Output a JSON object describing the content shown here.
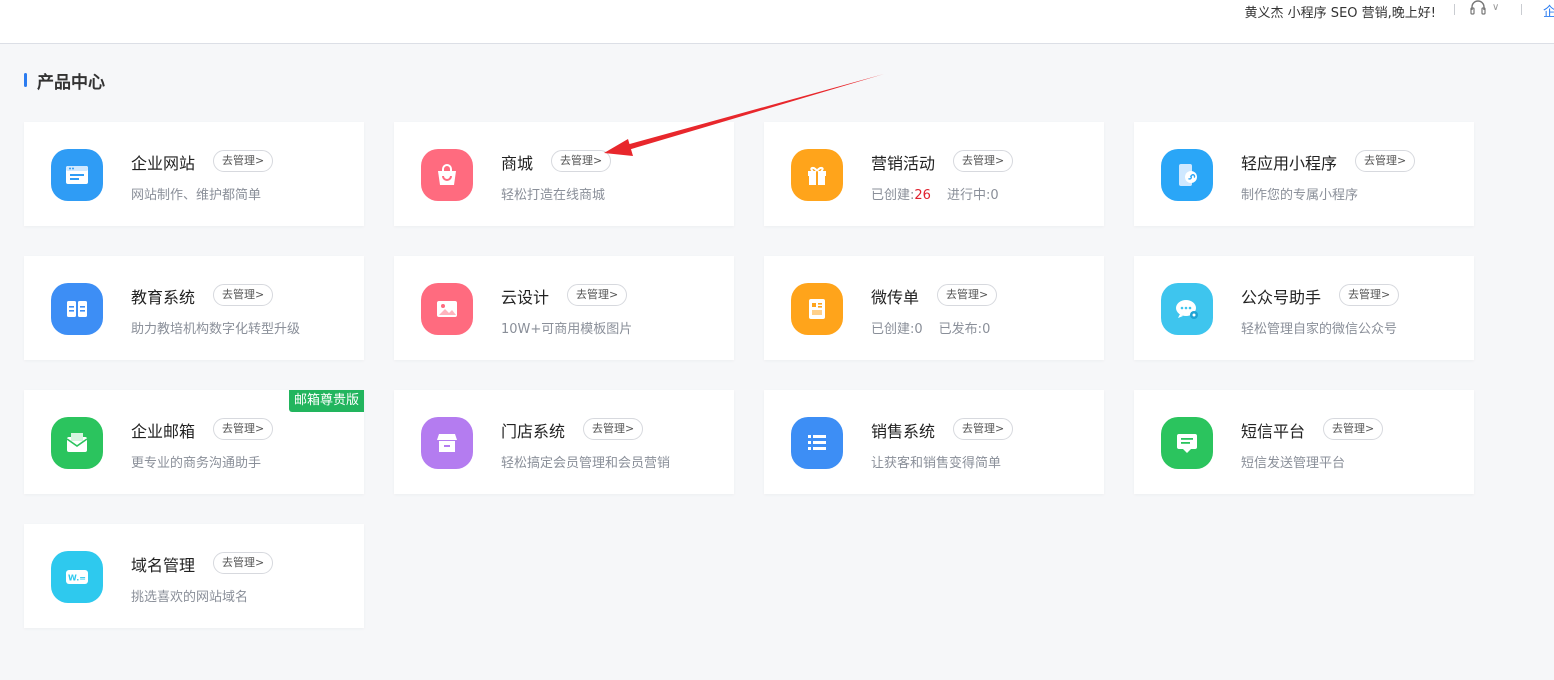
{
  "topbar": {
    "greeting": "黄义杰  小程序  SEO  营销,晚上好!",
    "right_text": "企"
  },
  "section": {
    "title": "产品中心"
  },
  "manage_label": "去管理>",
  "products": [
    {
      "title": "企业网站",
      "desc": "网站制作、维护都简单",
      "icon": "website-icon",
      "color": "#2f9cf5"
    },
    {
      "title": "商城",
      "desc": "轻松打造在线商城",
      "icon": "shopping-bag-icon",
      "color": "#ff6b7f"
    },
    {
      "title": "营销活动",
      "stats": {
        "created_label": "已创建:",
        "created_value": "26",
        "running_label": "进行中:",
        "running_value": "0"
      },
      "icon": "gift-icon",
      "color": "#ffa41b"
    },
    {
      "title": "轻应用小程序",
      "desc": "制作您的专属小程序",
      "icon": "mini-program-icon",
      "color": "#2aa6f7"
    },
    {
      "title": "教育系统",
      "desc": "助力教培机构数字化转型升级",
      "icon": "book-icon",
      "color": "#3d8ef5"
    },
    {
      "title": "云设计",
      "desc": "10W+可商用模板图片",
      "icon": "image-icon",
      "color": "#ff6b7f"
    },
    {
      "title": "微传单",
      "stats": {
        "created_label": "已创建:",
        "created_value": "0",
        "running_label": "已发布:",
        "running_value": "0"
      },
      "icon": "flyer-icon",
      "color": "#ffa41b"
    },
    {
      "title": "公众号助手",
      "desc": "轻松管理自家的微信公众号",
      "icon": "wechat-icon",
      "color": "#3ec5ee"
    },
    {
      "title": "企业邮箱",
      "desc": "更专业的商务沟通助手",
      "icon": "mail-icon",
      "color": "#2bc45e",
      "badge": "邮箱尊贵版"
    },
    {
      "title": "门店系统",
      "desc": "轻松搞定会员管理和会员营销",
      "icon": "store-icon",
      "color": "#b47cf0"
    },
    {
      "title": "销售系统",
      "desc": "让获客和销售变得简单",
      "icon": "list-icon",
      "color": "#3d8ef5"
    },
    {
      "title": "短信平台",
      "desc": "短信发送管理平台",
      "icon": "sms-icon",
      "color": "#2bc45e"
    },
    {
      "title": "域名管理",
      "desc": "挑选喜欢的网站域名",
      "icon": "domain-icon",
      "color": "#2ec9ee",
      "icon_text": "W.="
    }
  ]
}
